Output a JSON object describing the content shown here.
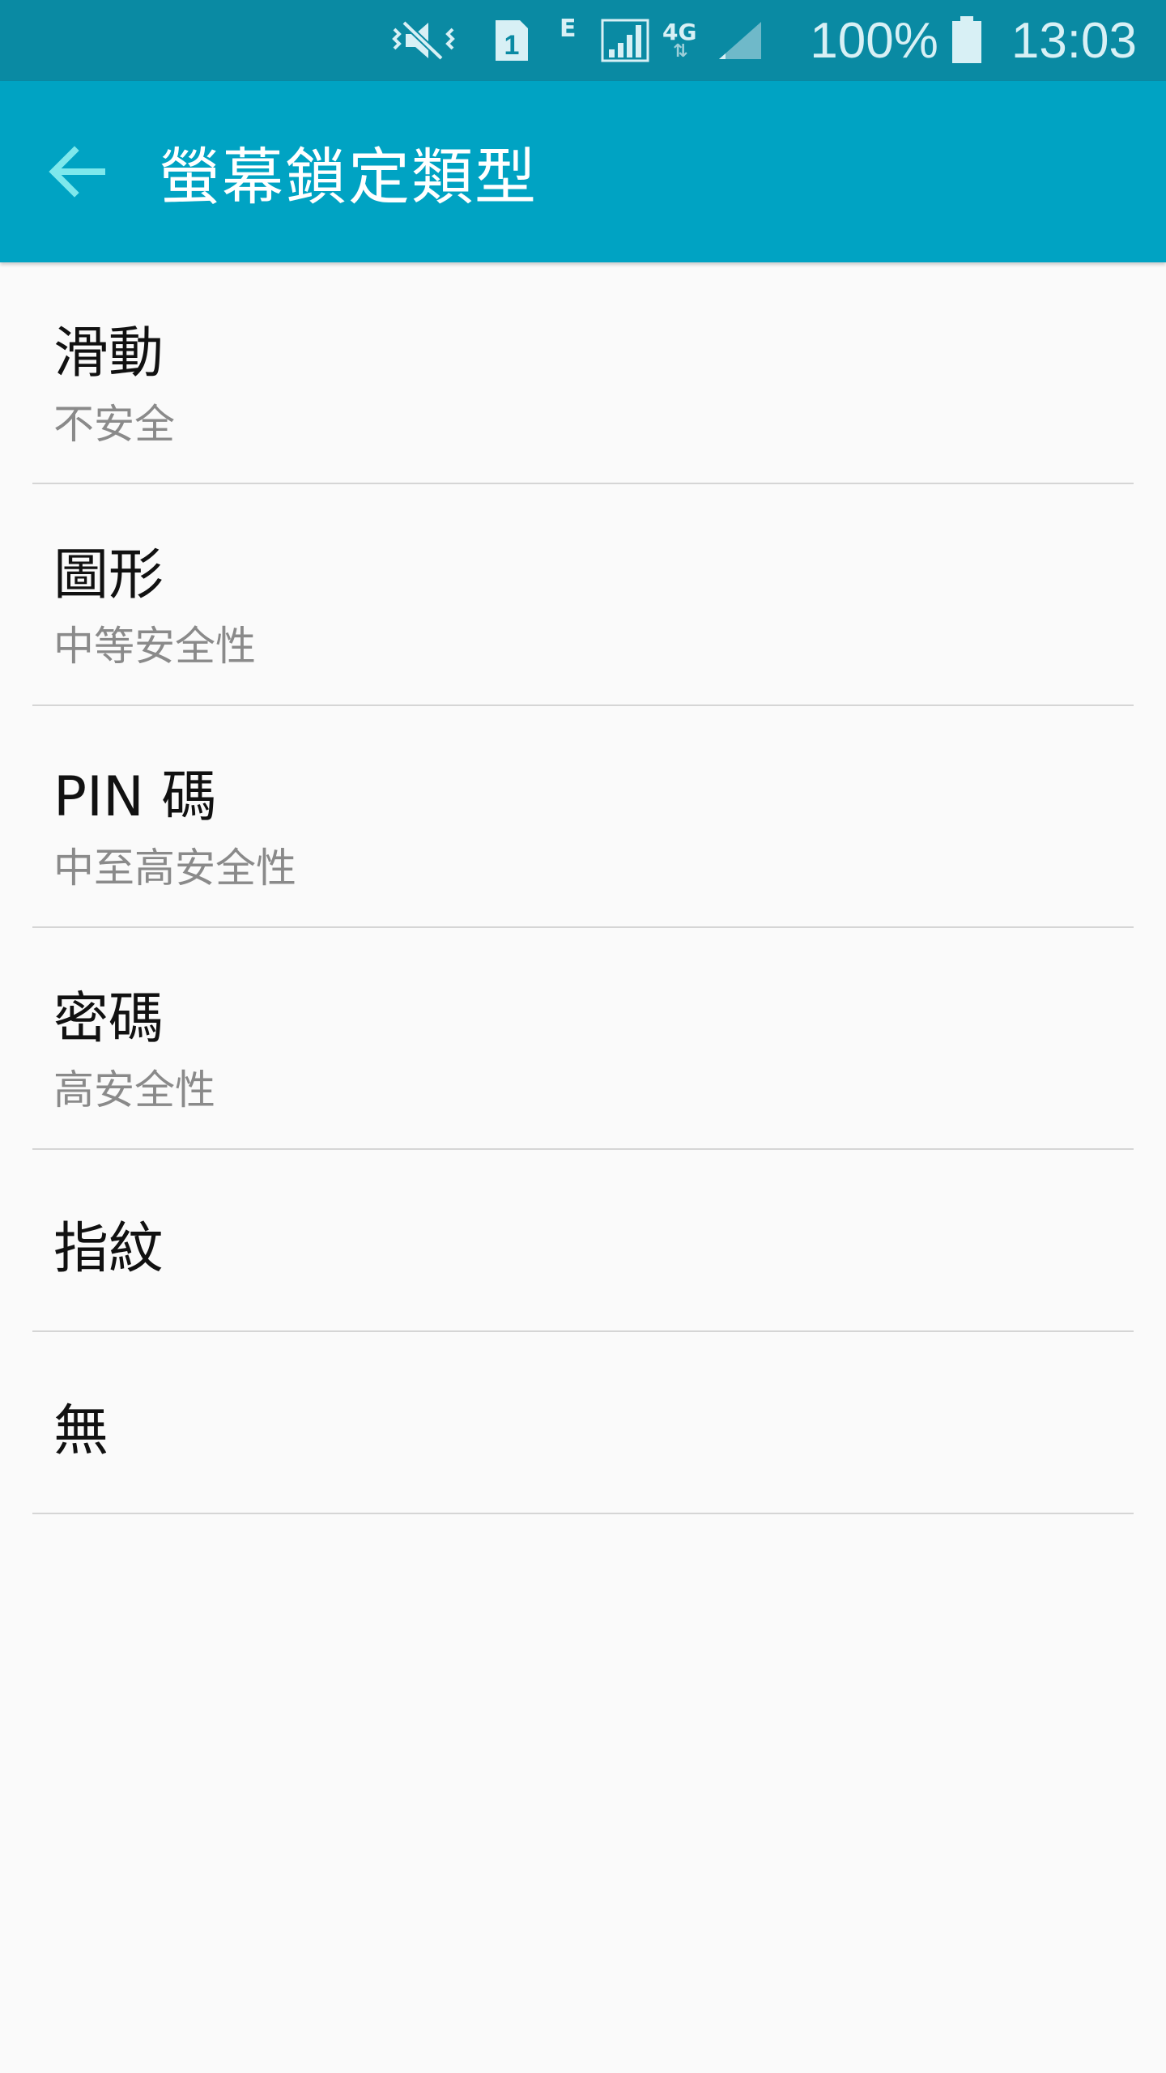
{
  "status_bar": {
    "network_type_e": "E",
    "network_type_4g": "4G",
    "network_arrows": "⇅",
    "sim_slot": "1",
    "battery_percent": "100%",
    "time": "13:03",
    "icons": [
      "vibrate-mute-icon",
      "sim-1-icon",
      "signal-icon",
      "signal-secondary-icon",
      "battery-icon"
    ]
  },
  "app_bar": {
    "back_icon": "arrow-left-icon",
    "title": "螢幕鎖定類型",
    "background_color": "#00a3c3",
    "accent_color": "#7ee8ec"
  },
  "lock_types": {
    "items": [
      {
        "title": "滑動",
        "subtitle": "不安全"
      },
      {
        "title": "圖形",
        "subtitle": "中等安全性"
      },
      {
        "title": "PIN 碼",
        "subtitle": "中至高安全性"
      },
      {
        "title": "密碼",
        "subtitle": "高安全性"
      },
      {
        "title": "指紋"
      },
      {
        "title": "無"
      }
    ]
  }
}
